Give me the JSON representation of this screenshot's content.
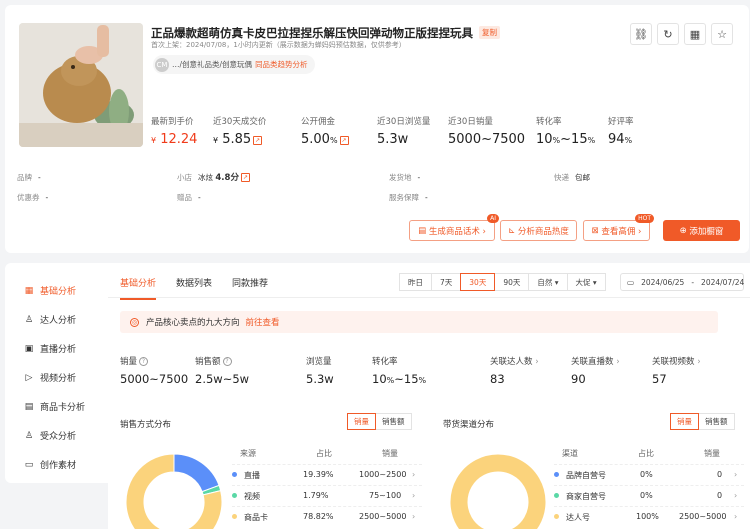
{
  "product": {
    "title": "正品爆款超萌仿真卡皮巴拉捏捏乐解压快回弹动物正版捏捏玩具",
    "copy_tag": "复制",
    "listing_info": "首次上架：2024/07/08，1小时内更新（展示数据为蝉妈妈预估数据，仅供参考）",
    "avatar_text": "CM",
    "category": "…/创意礼品类/创意玩偶",
    "category_link": "同品类趋势分析"
  },
  "top_icons": [
    "link-icon",
    "refresh-icon",
    "qrcode-icon",
    "star-icon"
  ],
  "stats": [
    {
      "label": "最新到手价",
      "currency": "¥",
      "value": "12.24",
      "red": true
    },
    {
      "label": "近30天成交价",
      "currency": "¥",
      "value": "5.85",
      "trend": "↗"
    },
    {
      "label": "公开佣金",
      "value": "5.00",
      "unit": "%",
      "trend": "↗"
    },
    {
      "label": "近30日浏览量",
      "value": "5.3w"
    },
    {
      "label": "近30日销量",
      "value": "5000~7500"
    },
    {
      "label": "转化率",
      "value": "10",
      "unit": "%",
      "value2": "~15",
      "unit2": "%"
    },
    {
      "label": "好评率",
      "value": "94",
      "unit": "%"
    }
  ],
  "info": {
    "brand": {
      "label": "品牌",
      "value": "-"
    },
    "shop": {
      "label": "小店",
      "name": "冰炫",
      "score": "4.8分",
      "trend": "↗"
    },
    "ship_from": {
      "label": "发货地",
      "value": "-"
    },
    "express": {
      "label": "快递",
      "value": "包邮"
    },
    "coupon": {
      "label": "优惠券",
      "value": "-"
    },
    "gift": {
      "label": "赠品",
      "value": "-"
    },
    "service": {
      "label": "服务保障",
      "value": "-"
    }
  },
  "actions": {
    "gen_copy": "生成商品话术 ›",
    "gen_copy_badge": "AI",
    "analyze_heat": "分析商品热度",
    "view_commission": "查看高佣 ›",
    "commission_badge": "HOT",
    "add_window": "添加橱窗"
  },
  "sidebar": [
    {
      "label": "基础分析",
      "icon": "chart-icon",
      "glyph": "▦",
      "active": true
    },
    {
      "label": "达人分析",
      "icon": "user-icon",
      "glyph": "♙",
      "active": false
    },
    {
      "label": "直播分析",
      "icon": "live-icon",
      "glyph": "▣",
      "active": false
    },
    {
      "label": "视频分析",
      "icon": "play-icon",
      "glyph": "▷",
      "active": false
    },
    {
      "label": "商品卡分析",
      "icon": "card-icon",
      "glyph": "▤",
      "active": false
    },
    {
      "label": "受众分析",
      "icon": "audience-icon",
      "glyph": "♙",
      "active": false
    },
    {
      "label": "创作素材",
      "icon": "folder-icon",
      "glyph": "▭",
      "active": false
    }
  ],
  "tabs": [
    {
      "label": "基础分析",
      "active": true
    },
    {
      "label": "数据列表",
      "active": false
    },
    {
      "label": "同款推荐",
      "active": false
    }
  ],
  "date_ranges": [
    {
      "label": "昨日",
      "active": false
    },
    {
      "label": "7天",
      "active": false
    },
    {
      "label": "30天",
      "active": true
    },
    {
      "label": "90天",
      "active": false
    },
    {
      "label": "自然 ▾",
      "active": false
    },
    {
      "label": "大促 ▾",
      "active": false
    }
  ],
  "date_picker": {
    "start": "2024/06/25",
    "separator": "-",
    "end": "2024/07/24"
  },
  "notice": {
    "text": "产品核心卖点的九大方向",
    "link": "前往查看"
  },
  "metrics": [
    {
      "label": "销量",
      "help": true,
      "value": "5000~7500"
    },
    {
      "label": "销售额",
      "help": true,
      "value": "2.5w~5w"
    },
    {
      "label": "浏览量",
      "value": "5.3w"
    },
    {
      "label": "转化率",
      "value": "10",
      "unit": "%",
      "value2": "~15",
      "unit2": "%"
    },
    {
      "label": "关联达人数",
      "arrow": "›",
      "value": "83"
    },
    {
      "label": "关联直播数",
      "arrow": "›",
      "value": "90"
    },
    {
      "label": "关联视频数",
      "arrow": "›",
      "value": "57"
    }
  ],
  "sales_dist": {
    "title": "销售方式分布",
    "toggle": [
      {
        "label": "销量",
        "active": true
      },
      {
        "label": "销售额",
        "active": false
      }
    ],
    "headers": {
      "source": "来源",
      "share": "占比",
      "sales": "销量"
    },
    "rows": [
      {
        "name": "直播",
        "share": "19.39%",
        "sales": "1000~2500",
        "color": "#5b8ff9"
      },
      {
        "name": "视频",
        "share": "1.79%",
        "sales": "75~100",
        "color": "#5ad8a6"
      },
      {
        "name": "商品卡",
        "share": "78.82%",
        "sales": "2500~5000",
        "color": "#fbd37c"
      }
    ]
  },
  "channel_dist": {
    "title": "带货渠道分布",
    "toggle": [
      {
        "label": "销量",
        "active": true
      },
      {
        "label": "销售额",
        "active": false
      }
    ],
    "headers": {
      "channel": "渠道",
      "share": "占比",
      "sales": "销量"
    },
    "rows": [
      {
        "name": "品牌自营号",
        "share": "0%",
        "sales": "0",
        "color": "#5b8ff9"
      },
      {
        "name": "商家自营号",
        "share": "0%",
        "sales": "0",
        "color": "#5ad8a6"
      },
      {
        "name": "达人号",
        "share": "100%",
        "sales": "2500~5000",
        "color": "#fbd37c"
      }
    ]
  },
  "chart_data": [
    {
      "type": "pie",
      "title": "销售方式分布",
      "categories": [
        "直播",
        "视频",
        "商品卡"
      ],
      "values": [
        19.39,
        1.79,
        78.82
      ]
    },
    {
      "type": "pie",
      "title": "带货渠道分布",
      "categories": [
        "品牌自营号",
        "商家自营号",
        "达人号"
      ],
      "values": [
        0,
        0,
        100
      ]
    }
  ],
  "colors": {
    "accent": "#f05a28",
    "price_red": "#f03b1a",
    "notice_bg": "#fef2ee"
  }
}
